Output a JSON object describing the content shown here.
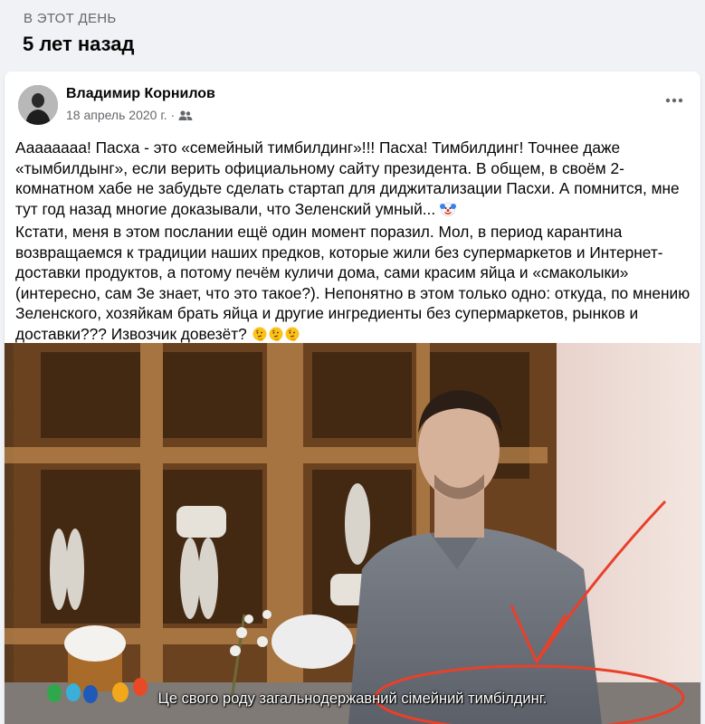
{
  "memory": {
    "label": "В ЭТОТ ДЕНЬ",
    "title": "5 лет назад"
  },
  "post": {
    "author": "Владимир Корнилов",
    "date": "18 апрель 2020 г.",
    "separator": "·",
    "audience_icon": "friends-icon",
    "more_icon": "more-options-icon",
    "paragraph1": "Аааааааа! Пасха - это «семейный тимбилдинг»!!! Пасха! Тимбилдинг! Точнее даже «тымбилдынг», если верить официальному сайту президента. В общем, в своём 2-комнатном хабе не забудьте сделать стартап для диджитализации Пасхи. А помнится, мне тут год назад многие доказывали, что Зеленский умный...",
    "paragraph1_emoji": "clown-face-emoji",
    "paragraph2": "Кстати, меня в этом послании ещё один момент поразил. Мол, в период карантина возвращаемся к традиции наших предков, которые жили без супермаркетов и Интернет-доставки продуктов, а потому печём куличи дома, сами красим яйца и «смаколыки» (интересно, сам Зе знает, что это такое?). Непонятно в этом только одно: откуда, по мнению Зеленского, хозяйкам брать яйца и другие ингредиенты без супермаркетов, рынков и доставки??? Извозчик довезёт?",
    "paragraph2_emoji": "thinking-face-emoji",
    "image": {
      "subtitle": "Це свого роду загальнодержавний сімейний тимбілдинг.",
      "annotation_color": "#e8402a"
    }
  }
}
